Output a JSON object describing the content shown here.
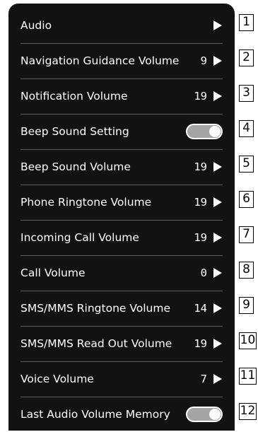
{
  "settings": [
    {
      "label": "Audio",
      "value": "",
      "control": "arrow",
      "callout": "1"
    },
    {
      "label": "Navigation Guidance Volume",
      "value": "9",
      "control": "arrow",
      "callout": "2"
    },
    {
      "label": "Notification Volume",
      "value": "19",
      "control": "arrow",
      "callout": "3"
    },
    {
      "label": "Beep Sound Setting",
      "value": "",
      "control": "toggle",
      "toggle_on": true,
      "callout": "4"
    },
    {
      "label": "Beep Sound Volume",
      "value": "19",
      "control": "arrow",
      "callout": "5"
    },
    {
      "label": "Phone Ringtone Volume",
      "value": "19",
      "control": "arrow",
      "callout": "6"
    },
    {
      "label": "Incoming Call Volume",
      "value": "19",
      "control": "arrow",
      "callout": "7"
    },
    {
      "label": "Call Volume",
      "value": "0",
      "control": "arrow",
      "callout": "8"
    },
    {
      "label": "SMS/MMS Ringtone Volume",
      "value": "14",
      "control": "arrow",
      "callout": "9"
    },
    {
      "label": "SMS/MMS Read Out Volume",
      "value": "19",
      "control": "arrow",
      "callout": "10"
    },
    {
      "label": "Voice Volume",
      "value": "7",
      "control": "arrow",
      "callout": "11"
    },
    {
      "label": "Last Audio Volume Memory",
      "value": "",
      "control": "toggle",
      "toggle_on": true,
      "callout": "12"
    }
  ],
  "colors": {
    "panel_background": "#121212",
    "divider": "#5c5c5c",
    "text": "#ffffff",
    "toggle_track": "#a4a4a4",
    "toggle_knob": "#ffffff"
  }
}
